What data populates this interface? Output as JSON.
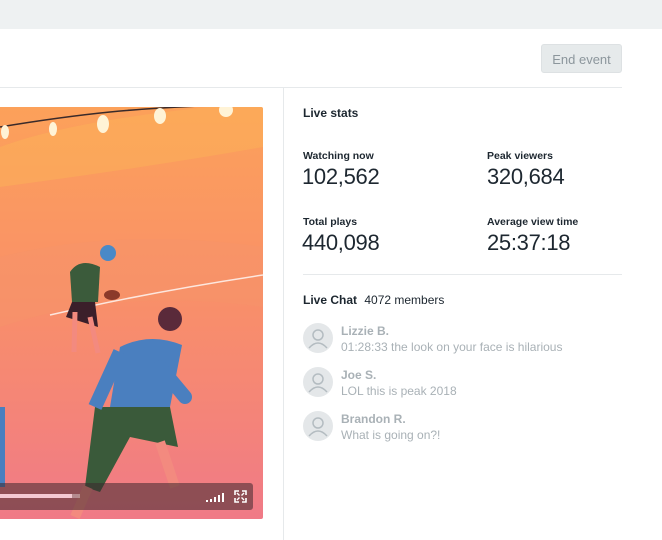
{
  "header": {
    "end_event_label": "End event"
  },
  "video": {
    "progress": 0.9
  },
  "stats": {
    "title": "Live stats",
    "watching_now": {
      "label": "Watching now",
      "value": "102,562"
    },
    "peak_viewers": {
      "label": "Peak viewers",
      "value": "320,684"
    },
    "total_plays": {
      "label": "Total plays",
      "value": "440,098"
    },
    "average_view_time": {
      "label": "Average view time",
      "value": "25:37:18"
    }
  },
  "chat": {
    "title": "Live Chat",
    "members": "4072 members",
    "messages": [
      {
        "name": "Lizzie B.",
        "text": "01:28:33 the look on your face is hilarious"
      },
      {
        "name": "Joe S.",
        "text": "LOL this is peak 2018"
      },
      {
        "name": "Brandon R.",
        "text": "What is going on?!"
      }
    ]
  },
  "colors": {
    "accent_muted": "#e6eaeb",
    "video_sky_top": "#fb9a5c",
    "video_sky_bottom": "#f27f86"
  }
}
